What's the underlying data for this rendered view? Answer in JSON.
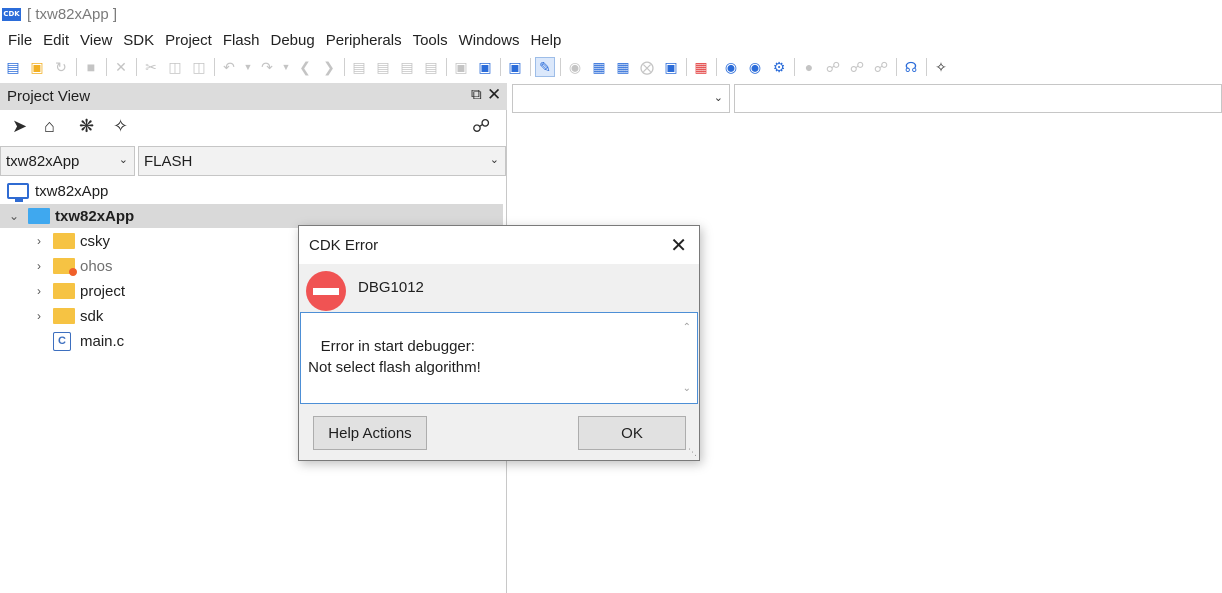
{
  "window": {
    "logo_text": "CDK",
    "title": "[ txw82xApp ]"
  },
  "menu": {
    "items": [
      "File",
      "Edit",
      "View",
      "SDK",
      "Project",
      "Flash",
      "Debug",
      "Peripherals",
      "Tools",
      "Windows",
      "Help"
    ]
  },
  "toolbar": {
    "icons": [
      "new-file-icon",
      "open-folder-icon",
      "reload-icon",
      "save-icon",
      "close-icon",
      "cut-icon",
      "copy-icon",
      "paste-icon",
      "undo-icon",
      "redo-icon",
      "back-icon",
      "forward-icon",
      "build-icon",
      "rebuild-icon",
      "clean-icon",
      "stop-build-icon",
      "search-icon",
      "find-file-icon",
      "find-in-project-icon",
      "edit-icon",
      "package-icon",
      "download-icon",
      "erase-icon",
      "cancel-icon",
      "flash-icon",
      "load-icon",
      "debug-icon",
      "debug-start-icon",
      "settings-icon",
      "record-icon",
      "link-icon",
      "unlink-icon",
      "breakpoint-icon",
      "headset-icon",
      "chip-icon"
    ]
  },
  "project_view": {
    "title": "Project View",
    "tool_icons": [
      "navigate-icon",
      "home-icon",
      "network-icon",
      "chip-icon",
      "link-icon"
    ],
    "project_select": "txw82xApp",
    "target_select": "FLASH",
    "workspace": "txw82xApp",
    "project": "txw82xApp",
    "tree": [
      {
        "label": "csky",
        "type": "folder"
      },
      {
        "label": "ohos",
        "type": "folder-modified"
      },
      {
        "label": "project",
        "type": "folder"
      },
      {
        "label": "sdk",
        "type": "folder"
      },
      {
        "label": "main.c",
        "type": "c-file"
      }
    ]
  },
  "editor": {
    "file_select": "",
    "symbol_select": ""
  },
  "dialog": {
    "title": "CDK Error",
    "code": "DBG1012",
    "message": "Error in start debugger:\n Not select flash algorithm!",
    "help_button": "Help Actions",
    "ok_button": "OK"
  },
  "colors": {
    "accent": "#2b6cd9",
    "error": "#f05353",
    "folder": "#f6c343",
    "project_folder": "#3fa8ef",
    "panel_header": "#dcdcdc"
  }
}
